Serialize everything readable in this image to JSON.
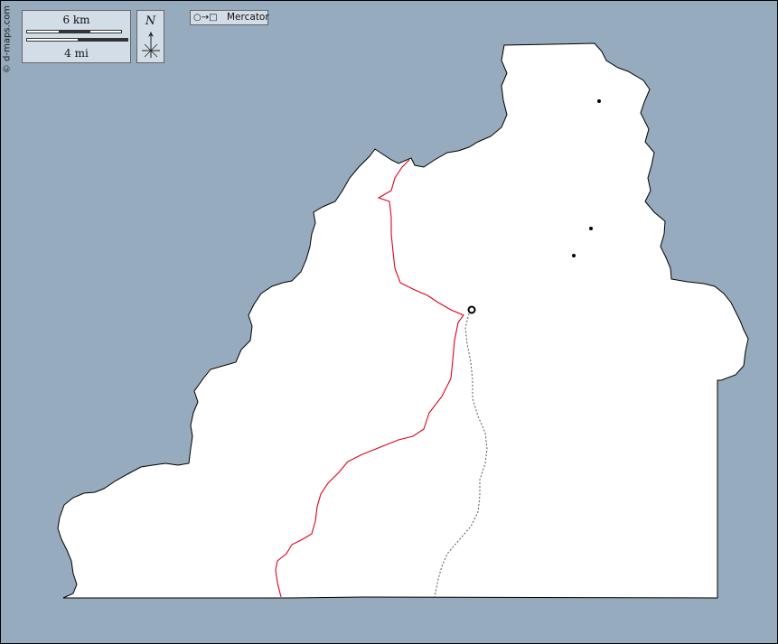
{
  "map": {
    "credit": "© d-maps.com",
    "scale": {
      "km_label": "6 km",
      "mi_label": "4 mi"
    },
    "north_label": "N",
    "projection": {
      "symbol": "○→□",
      "label": "Mercator"
    },
    "colors": {
      "water": "#96abbd",
      "land": "#ffffff",
      "border_red": "#e0001b",
      "panel": "#d3dde7"
    },
    "icons": [
      "compass-rose-icon",
      "town-dot-icon",
      "capital-circle-icon"
    ]
  }
}
